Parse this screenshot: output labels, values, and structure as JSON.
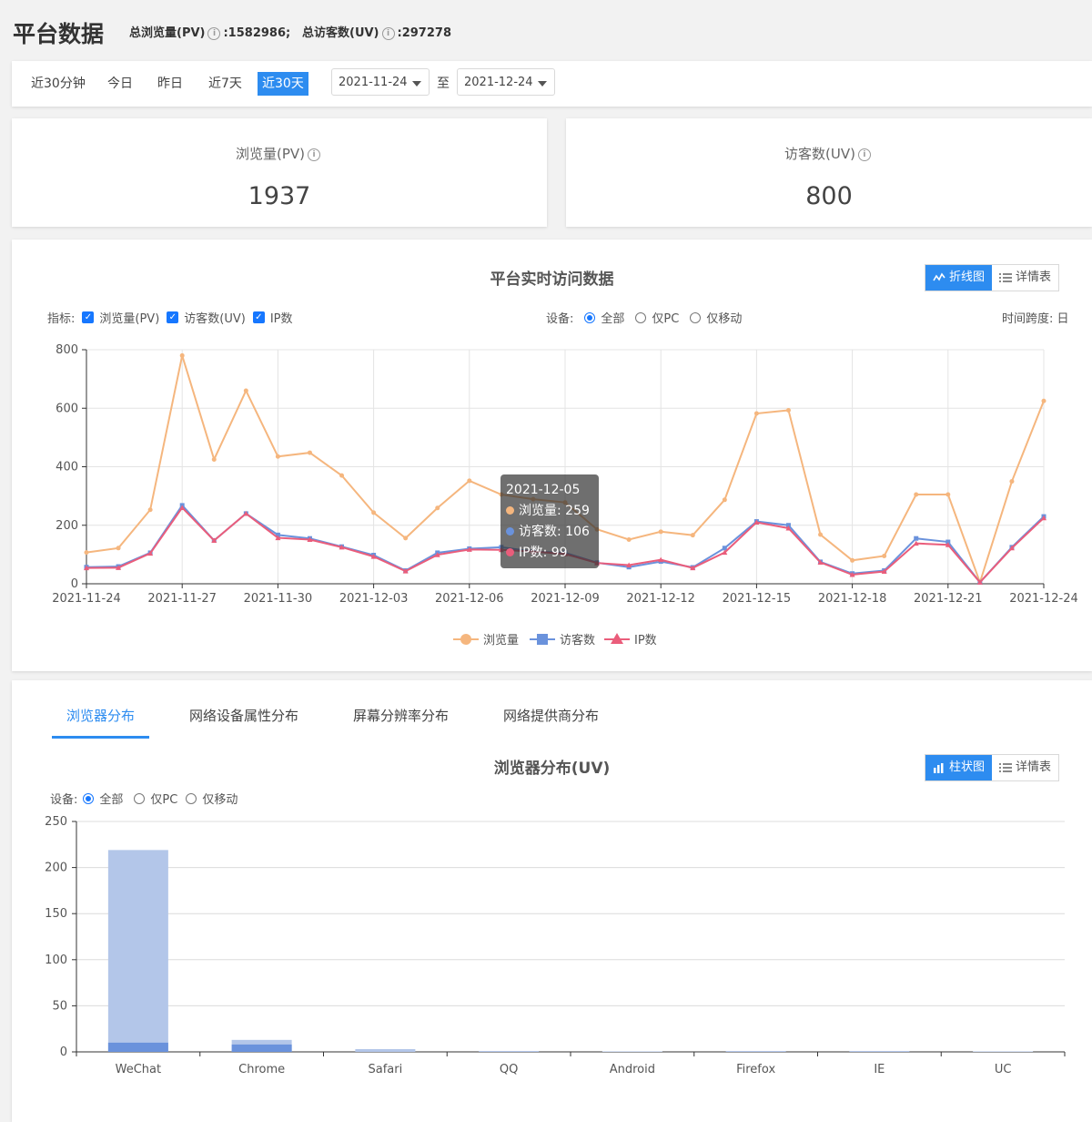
{
  "header": {
    "title": "平台数据",
    "total_pv_label": "总浏览量(PV)",
    "total_pv_value": ":1582986;",
    "total_uv_label": "总访客数(UV)",
    "total_uv_value": ":297278"
  },
  "filters": {
    "quick_ranges": [
      "近30分钟",
      "今日",
      "昨日",
      "近7天",
      "近30天"
    ],
    "active_range": "近30天",
    "start_date": "2021-11-24",
    "to_label": "至",
    "end_date": "2021-12-24"
  },
  "kpis": {
    "pv_label": "浏览量(PV)",
    "pv_value": "1937",
    "uv_label": "访客数(UV)",
    "uv_value": "800"
  },
  "line_panel": {
    "title": "平台实时访问数据",
    "view_toggle": {
      "line": "折线图",
      "table": "详情表",
      "active": "line"
    },
    "metrics_label": "指标:",
    "metrics": [
      "浏览量(PV)",
      "访客数(UV)",
      "IP数"
    ],
    "device_label": "设备:",
    "devices": [
      "全部",
      "仅PC",
      "仅移动"
    ],
    "selected_device": "全部",
    "span_label": "时间跨度: 日",
    "tooltip": {
      "date": "2021-12-05",
      "rows": [
        {
          "label": "浏览量: 259",
          "color": "#f5b67e"
        },
        {
          "label": "访客数: 106",
          "color": "#6a92dc"
        },
        {
          "label": "IP数: 99",
          "color": "#ea5d7b"
        }
      ]
    }
  },
  "browser_panel": {
    "tabs": [
      "浏览器分布",
      "网络设备属性分布",
      "屏幕分辨率分布",
      "网络提供商分布"
    ],
    "active_tab": "浏览器分布",
    "title": "浏览器分布(UV)",
    "view_toggle": {
      "bar": "柱状图",
      "table": "详情表",
      "active": "bar"
    },
    "device_label": "设备:",
    "devices": [
      "全部",
      "仅PC",
      "仅移动"
    ],
    "selected_device": "全部"
  },
  "chart_data": [
    {
      "type": "line",
      "title": "平台实时访问数据",
      "x": [
        "2021-11-24",
        "2021-11-25",
        "2021-11-26",
        "2021-11-27",
        "2021-11-28",
        "2021-11-29",
        "2021-11-30",
        "2021-12-01",
        "2021-12-02",
        "2021-12-03",
        "2021-12-04",
        "2021-12-05",
        "2021-12-06",
        "2021-12-07",
        "2021-12-08",
        "2021-12-09",
        "2021-12-10",
        "2021-12-11",
        "2021-12-12",
        "2021-12-13",
        "2021-12-14",
        "2021-12-15",
        "2021-12-16",
        "2021-12-17",
        "2021-12-18",
        "2021-12-19",
        "2021-12-20",
        "2021-12-21",
        "2021-12-22",
        "2021-12-23",
        "2021-12-24"
      ],
      "x_tick_labels": [
        "2021-11-24",
        "2021-11-27",
        "2021-11-30",
        "2021-12-03",
        "2021-12-06",
        "2021-12-09",
        "2021-12-12",
        "2021-12-15",
        "2021-12-18",
        "2021-12-21",
        "2021-12-24"
      ],
      "ylim": [
        0,
        800
      ],
      "yticks": [
        0,
        200,
        400,
        600,
        800
      ],
      "grid": true,
      "legend_position": "bottom",
      "series": [
        {
          "name": "浏览量",
          "color": "#f5b67e",
          "marker": "circle",
          "values": [
            107,
            122,
            253,
            780,
            425,
            660,
            435,
            448,
            370,
            243,
            156,
            259,
            352,
            305,
            289,
            278,
            186,
            151,
            178,
            166,
            287,
            582,
            593,
            168,
            80,
            95,
            305,
            305,
            5,
            350,
            625
          ]
        },
        {
          "name": "访客数",
          "color": "#6a92dc",
          "marker": "square",
          "values": [
            57,
            59,
            106,
            268,
            148,
            240,
            167,
            155,
            127,
            98,
            45,
            106,
            120,
            125,
            110,
            106,
            72,
            57,
            76,
            56,
            122,
            213,
            200,
            75,
            35,
            45,
            155,
            143,
            5,
            125,
            230
          ]
        },
        {
          "name": "IP数",
          "color": "#ea5d7b",
          "marker": "triangle",
          "values": [
            54,
            55,
            104,
            260,
            148,
            240,
            157,
            151,
            125,
            93,
            43,
            99,
            117,
            116,
            110,
            102,
            71,
            64,
            82,
            54,
            107,
            210,
            190,
            73,
            31,
            42,
            138,
            133,
            5,
            122,
            225
          ]
        }
      ]
    },
    {
      "type": "bar",
      "title": "浏览器分布(UV)",
      "categories": [
        "WeChat",
        "Chrome",
        "Safari",
        "QQ",
        "Android",
        "Firefox",
        "IE",
        "UC"
      ],
      "ylim": [
        0,
        250
      ],
      "yticks": [
        0,
        50,
        100,
        150,
        200,
        250
      ],
      "grid": true,
      "series": [
        {
          "color": "#b3c6e9",
          "values": [
            219,
            13,
            3,
            1,
            0.5,
            1,
            1,
            0.5
          ]
        },
        {
          "color": "#6a92dc",
          "values": [
            10,
            8,
            0,
            0,
            0,
            0,
            0,
            0
          ]
        }
      ]
    }
  ]
}
